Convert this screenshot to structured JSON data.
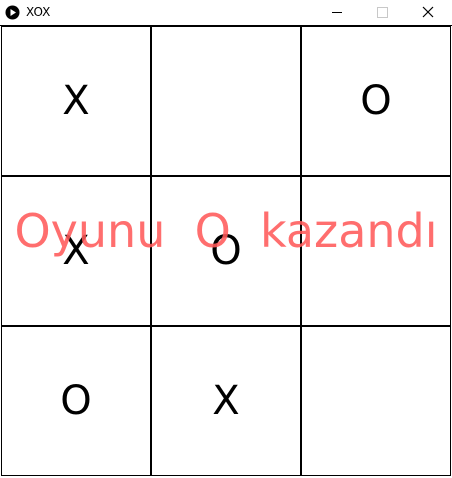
{
  "window": {
    "title": "XOX",
    "icon": "play-circle-icon",
    "controls": [
      "minimize-icon",
      "maximize-icon",
      "close-icon"
    ]
  },
  "board": {
    "cells": [
      "X",
      "",
      "O",
      "X",
      "O",
      "",
      "O",
      "X",
      ""
    ]
  },
  "status": {
    "message": "Oyunu  O  kazandı",
    "color": "#ff5a5a"
  }
}
